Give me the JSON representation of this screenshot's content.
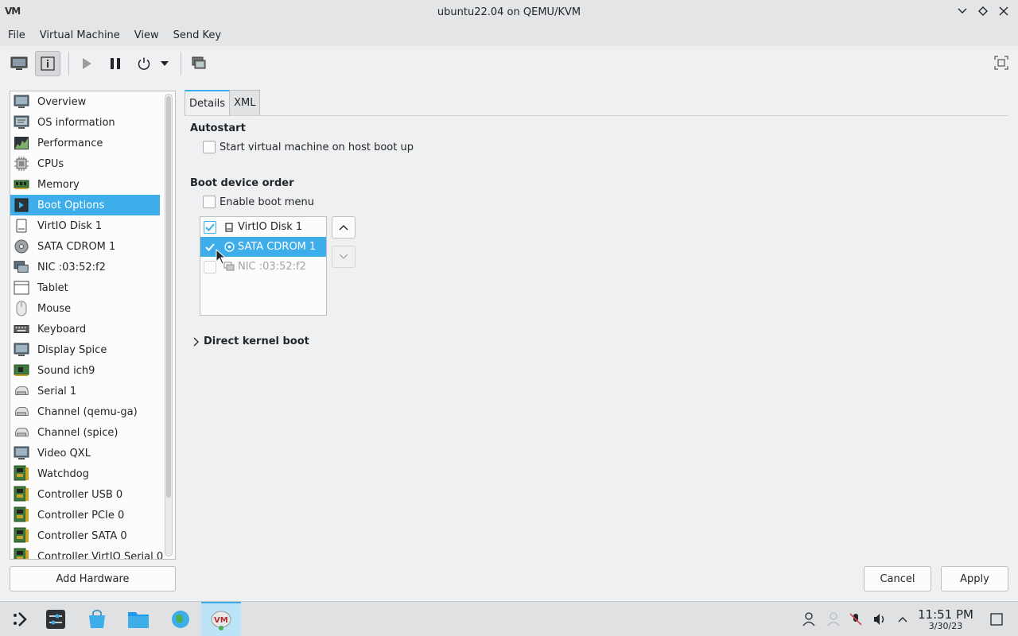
{
  "window": {
    "title": "ubuntu22.04 on QEMU/KVM",
    "logo_text": "VM"
  },
  "menu": [
    "File",
    "Virtual Machine",
    "View",
    "Send Key"
  ],
  "sidebar": {
    "items": [
      {
        "label": "Overview",
        "icon": "monitor-icon"
      },
      {
        "label": "OS information",
        "icon": "monitor-info-icon"
      },
      {
        "label": "Performance",
        "icon": "performance-graph-icon"
      },
      {
        "label": "CPUs",
        "icon": "cpu-chip-icon"
      },
      {
        "label": "Memory",
        "icon": "memory-icon"
      },
      {
        "label": "Boot Options",
        "icon": "boot-options-icon",
        "selected": true
      },
      {
        "label": "VirtIO Disk 1",
        "icon": "disk-icon"
      },
      {
        "label": "SATA CDROM 1",
        "icon": "cdrom-icon"
      },
      {
        "label": "NIC :03:52:f2",
        "icon": "network-icon"
      },
      {
        "label": "Tablet",
        "icon": "tablet-icon"
      },
      {
        "label": "Mouse",
        "icon": "mouse-icon"
      },
      {
        "label": "Keyboard",
        "icon": "keyboard-icon"
      },
      {
        "label": "Display Spice",
        "icon": "display-icon"
      },
      {
        "label": "Sound ich9",
        "icon": "sound-card-icon"
      },
      {
        "label": "Serial 1",
        "icon": "serial-icon"
      },
      {
        "label": "Channel (qemu-ga)",
        "icon": "channel-icon"
      },
      {
        "label": "Channel (spice)",
        "icon": "channel-icon"
      },
      {
        "label": "Video QXL",
        "icon": "video-icon"
      },
      {
        "label": "Watchdog",
        "icon": "pci-card-icon"
      },
      {
        "label": "Controller USB 0",
        "icon": "pci-card-icon"
      },
      {
        "label": "Controller PCIe 0",
        "icon": "pci-card-icon"
      },
      {
        "label": "Controller SATA 0",
        "icon": "pci-card-icon"
      },
      {
        "label": "Controller VirtIO Serial 0",
        "icon": "pci-card-icon"
      }
    ],
    "add_hardware_label": "Add Hardware"
  },
  "tabs": {
    "details": "Details",
    "xml": "XML"
  },
  "autostart": {
    "title": "Autostart",
    "checkbox_label": "Start virtual machine on host boot up",
    "checked": false
  },
  "boot": {
    "title": "Boot device order",
    "enable_menu_label": "Enable boot menu",
    "enable_menu_checked": false,
    "devices": [
      {
        "label": "VirtIO Disk 1",
        "checked": true,
        "state": "normal",
        "icon": "disk-icon"
      },
      {
        "label": "SATA CDROM 1",
        "checked": true,
        "state": "selected",
        "icon": "cdrom-icon"
      },
      {
        "label": "NIC :03:52:f2",
        "checked": false,
        "state": "disabled",
        "icon": "network-icon"
      }
    ]
  },
  "direct_kernel_boot": {
    "label": "Direct kernel boot",
    "expanded": false
  },
  "buttons": {
    "cancel": "Cancel",
    "apply": "Apply"
  },
  "taskbar": {
    "clock_time": "11:51 PM",
    "clock_date": "3/30/23"
  },
  "colors": {
    "accent": "#3daee9",
    "background": "#eff0f1"
  }
}
